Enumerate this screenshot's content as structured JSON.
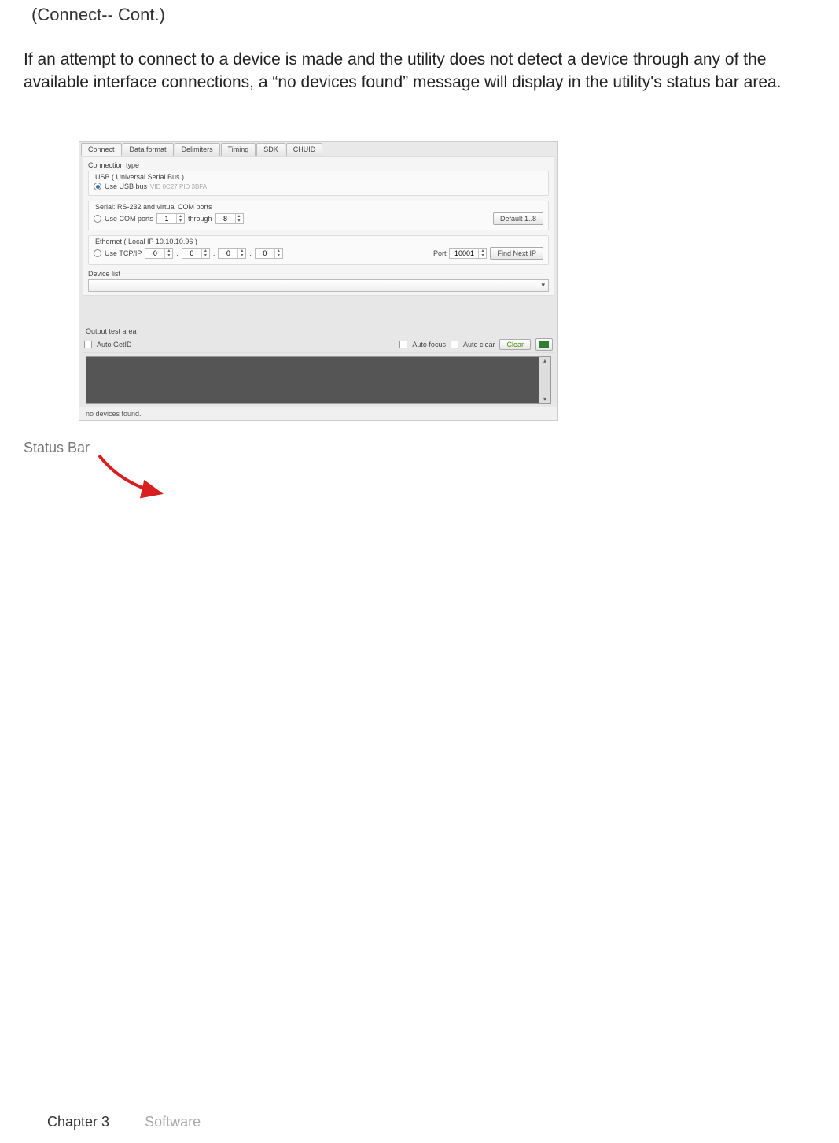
{
  "heading": "(Connect-- Cont.)",
  "body": "If an attempt to connect to a device is made and the utility does not detect a device through any of the available interface connections, a “no devices found” message will display in the utility's status bar area.",
  "callout": "Status Bar",
  "window": {
    "tabs": [
      "Connect",
      "Data format",
      "Delimiters",
      "Timing",
      "SDK",
      "CHUID"
    ],
    "active_tab": 0,
    "section_title": "Connection type",
    "usb": {
      "legend": "USB ( Universal Serial Bus )",
      "radio_label": "Use USB bus",
      "radio_checked": true,
      "hint": "VID 0C27  PID 3BFA"
    },
    "serial": {
      "legend": "Serial: RS-232 and virtual COM ports",
      "radio_label": "Use COM ports",
      "radio_checked": false,
      "from": "1",
      "to_label": "through",
      "to": "8",
      "button": "Default 1..8"
    },
    "ethernet": {
      "legend": "Ethernet ( Local IP  10.10.10.96 )",
      "radio_label": "Use TCP/IP",
      "radio_checked": false,
      "ip": [
        "0",
        "0",
        "0",
        "0"
      ],
      "port_label": "Port",
      "port": "10001",
      "button": "Find Next IP"
    },
    "device_list_label": "Device list",
    "output": {
      "title": "Output test area",
      "auto_getid": "Auto GetID",
      "auto_focus": "Auto focus",
      "auto_clear": "Auto clear",
      "clear": "Clear"
    },
    "status": "no devices found."
  },
  "footer": {
    "chapter": "Chapter 3",
    "title": "Software"
  }
}
